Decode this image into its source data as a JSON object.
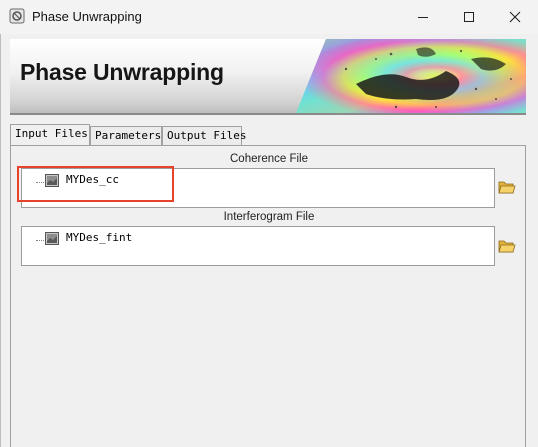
{
  "window": {
    "title": "Phase Unwrapping",
    "icon": "app-icon",
    "controls": [
      "minimize-icon",
      "maximize-icon",
      "close-icon"
    ]
  },
  "banner": {
    "title": "Phase Unwrapping"
  },
  "tabs": [
    {
      "label": "Input Files",
      "active": true
    },
    {
      "label": "Parameters",
      "active": false
    },
    {
      "label": "Output Files",
      "active": false
    }
  ],
  "coherence": {
    "label": "Coherence File",
    "file": "MYDes_cc"
  },
  "interferogram": {
    "label": "Interferogram File",
    "file": "MYDes_fint"
  },
  "colors": {
    "highlight": "#e8412c",
    "banner_shadow": "#8a8a8a"
  }
}
